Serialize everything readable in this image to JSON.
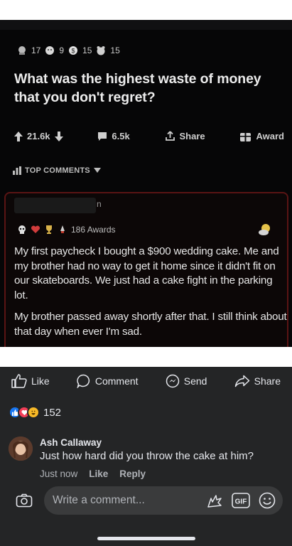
{
  "post": {
    "awards": [
      {
        "icon": "silver-award-icon",
        "count": "17"
      },
      {
        "icon": "helpful-award-icon",
        "count": "9"
      },
      {
        "icon": "gold-award-icon",
        "count": "15"
      },
      {
        "icon": "wholesome-award-icon",
        "count": "15"
      }
    ],
    "title": "What was the highest waste of money that you don't regret?",
    "upvotes": "21.6k",
    "comments": "6.5k",
    "share": "Share",
    "award": "Award"
  },
  "top_comments_label": "TOP COMMENTS",
  "top_comment": {
    "username_tail": "n",
    "awards_label": "186 Awards",
    "paragraph1": "My first paycheck I bought a $900 wedding cake. Me and my brother had no way to get it home since it didn't fit on our skateboards. We just had a cake fight in the parking lot.",
    "paragraph2": "My brother passed away shortly after that. I still think about that day when ever I'm sad."
  },
  "fb": {
    "like": "Like",
    "comment": "Comment",
    "send": "Send",
    "share": "Share",
    "reaction_count": "152",
    "reply": {
      "author": "Ash Callaway",
      "text": "Just how hard did you throw the cake at him?",
      "time": "Just now",
      "like": "Like",
      "reply": "Reply"
    },
    "write_placeholder": "Write a comment...",
    "colors": {
      "bg": "#242526",
      "like_blue": "#1877f2",
      "love_red": "#f33e58",
      "haha_yellow": "#f7b928"
    }
  }
}
